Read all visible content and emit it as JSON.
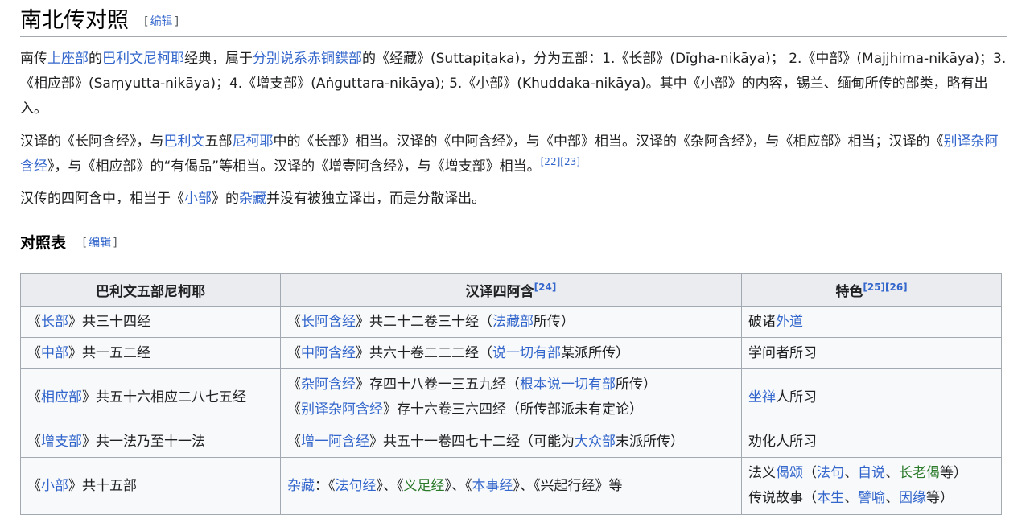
{
  "section": {
    "title": "南北传对照",
    "edit": "编辑",
    "edit_open": "[",
    "edit_close": "]"
  },
  "p1": {
    "t1": "南传",
    "l_theravada": "上座部",
    "t2": "的",
    "l_pali_nikaya": "巴利文尼柯耶",
    "t3": "经典，属于",
    "l_tamraparniya": "分别说系赤铜鍱部",
    "t4": "的《经藏》(Suttapiṭaka)，分为五部：1.《长部》(Dīgha-nikāya)； 2.《中部》(Majjhima-nikāya)；3.《相应部》(Saṃyutta-nikāya)；4.《增支部》(Aṅguttara-nikāya); 5.《小部》(Khuddaka-nikāya)。其中《小部》的内容，锡兰、缅甸所传的部类，略有出入。"
  },
  "p2": {
    "t1": "汉译的《长阿含经》，与",
    "l_pali": "巴利文",
    "t2": "五部",
    "l_nikaya": "尼柯耶",
    "t3": "中的《长部》相当。汉译的《中阿含经》，与《中部》相当。汉译的《杂阿含经》，与《相应部》相当；汉译的《",
    "l_biezayi": "别译杂阿含经",
    "t4": "》，与《相应部》的“有偈品”等相当。汉译的《增壹阿含经》，与《增支部》相当。",
    "ref1": "[22]",
    "ref2": "[23]"
  },
  "p3": {
    "t1": "汉传的四阿含中，相当于《",
    "l_xiaobu": "小部",
    "t2": "》的",
    "l_zazang": "杂藏",
    "t3": "并没有被独立译出，而是分散译出。"
  },
  "subsection": {
    "title": "对照表",
    "edit": "编辑",
    "edit_open": "[",
    "edit_close": "]"
  },
  "table": {
    "headers": {
      "col1": "巴利文五部尼柯耶",
      "col2": "汉译四阿含",
      "col2_ref": "[24]",
      "col3": "特色",
      "col3_ref1": "[25]",
      "col3_ref2": "[26]"
    },
    "rows": [
      {
        "c1_pre": "《",
        "c1_link": "长部",
        "c1_post": "》共三十四经",
        "c2_pre": "《",
        "c2_link": "长阿含经",
        "c2_mid": "》共二十二卷三十经（",
        "c2_link2": "法藏部",
        "c2_post": "所传）",
        "c3_pre": "破诸",
        "c3_link": "外道"
      },
      {
        "c1_pre": "《",
        "c1_link": "中部",
        "c1_post": "》共一五二经",
        "c2_pre": "《",
        "c2_link": "中阿含经",
        "c2_mid": "》共六十卷二二二经（",
        "c2_link2": "说一切有部",
        "c2_post": "某派所传）",
        "c3_text": "学问者所习"
      },
      {
        "c1_pre": "《",
        "c1_link": "相应部",
        "c1_post": "》共五十六相应二八七五经",
        "c2a_pre": "《",
        "c2a_link": "杂阿含经",
        "c2a_mid": "》存四十八卷一三五九经（",
        "c2a_link2": "根本说一切有部",
        "c2a_post": "所传）",
        "c2b_pre": "《",
        "c2b_link": "别译杂阿含经",
        "c2b_post": "》存十六卷三六四经（所传部派未有定论）",
        "c3_link": "坐禅",
        "c3_post": "人所习"
      },
      {
        "c1_pre": "《",
        "c1_link": "增支部",
        "c1_post": "》共一法乃至十一法",
        "c2_pre": "《",
        "c2_link": "增一阿含经",
        "c2_mid": "》共五十一卷四七十二经（可能为",
        "c2_link2": "大众部",
        "c2_post": "末派所传）",
        "c3_text": "劝化人所习"
      },
      {
        "c1_pre": "《",
        "c1_link": "小部",
        "c1_post": "》共十五部",
        "c2_link": "杂藏",
        "c2_t1": "：《",
        "c2_l2": "法句经",
        "c2_t2": "》、《",
        "c2_l3": "义足经",
        "c2_t3": "》、《",
        "c2_l4": "本事经",
        "c2_t4": "》、《兴起行经》等",
        "c3a_pre": "法义",
        "c3a_l1": "偈颂",
        "c3a_t1": "（",
        "c3a_l2": "法句",
        "c3a_t2": "、",
        "c3a_l3": "自说",
        "c3a_t3": "、",
        "c3a_l4": "长老偈",
        "c3a_t4": "等）",
        "c3b_pre": "传说故事（",
        "c3b_l1": "本生",
        "c3b_t1": "、",
        "c3b_l2": "譬喻",
        "c3b_t2": "、",
        "c3b_l3": "因缘",
        "c3b_t3": "等）"
      }
    ]
  }
}
